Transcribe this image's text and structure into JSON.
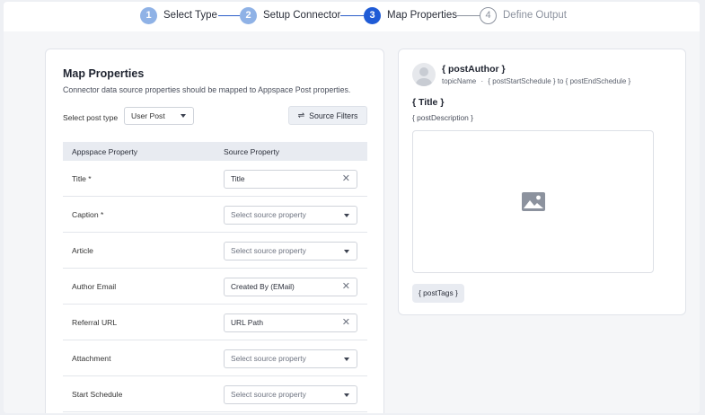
{
  "stepper": {
    "steps": [
      {
        "num": "1",
        "label": "Select Type"
      },
      {
        "num": "2",
        "label": "Setup Connector"
      },
      {
        "num": "3",
        "label": "Map Properties"
      },
      {
        "num": "4",
        "label": "Define Output"
      }
    ]
  },
  "map": {
    "title": "Map Properties",
    "description": "Connector data source properties should be mapped to Appspace Post properties.",
    "post_type_label": "Select post type",
    "post_type_value": "User Post",
    "filters_label": "Source Filters",
    "columns": {
      "appspace": "Appspace Property",
      "source": "Source Property"
    },
    "rows": [
      {
        "property": "Title *",
        "value": "Title"
      },
      {
        "property": "Caption *",
        "value": "Select source property"
      },
      {
        "property": "Article",
        "value": "Select source property"
      },
      {
        "property": "Author Email",
        "value": "Created By (EMail)"
      },
      {
        "property": "Referral URL",
        "value": "URL Path"
      },
      {
        "property": "Attachment",
        "value": "Select source property"
      },
      {
        "property": "Start Schedule",
        "value": "Select source property"
      }
    ]
  },
  "preview": {
    "author": "{ postAuthor }",
    "topic": "topicName",
    "schedule": "{ postStartSchedule } to { postEndSchedule }",
    "title": "{ Title }",
    "description": "{ postDescription }",
    "tags": "{ postTags }"
  },
  "colors": {
    "accent": "#1f5bd6",
    "completed_step": "#8fb2e6",
    "pending_step": "#8c929e"
  }
}
